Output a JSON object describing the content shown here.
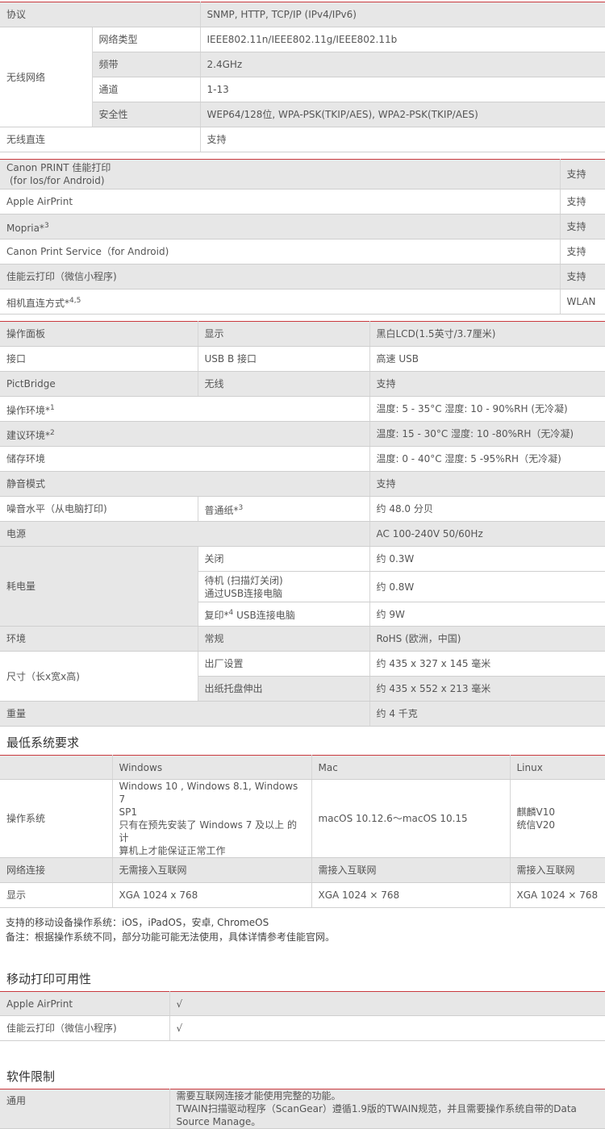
{
  "t1": {
    "protocol_label": "协议",
    "protocol_value": "SNMP, HTTP, TCP/IP (IPv4/IPv6)",
    "wireless_label": "无线网络",
    "net_type_label": "网络类型",
    "net_type_value": "IEEE802.11n/IEEE802.11g/IEEE802.11b",
    "band_label": "频带",
    "band_value": "2.4GHz",
    "channel_label": "通道",
    "channel_value": "1-13",
    "security_label": "安全性",
    "security_value": "WEP64/128位, WPA-PSK(TKIP/AES), WPA2-PSK(TKIP/AES)",
    "direct_label": "无线直连",
    "direct_value": "支持"
  },
  "t2": {
    "rows": [
      {
        "label": "Canon PRINT 佳能打印",
        "label2": "(for Ios/for Android)",
        "sup": "",
        "value": "支持"
      },
      {
        "label": "Apple AirPrint",
        "label2": "",
        "sup": "",
        "value": "支持"
      },
      {
        "label": "Mopria*",
        "label2": "",
        "sup": "3",
        "value": "支持"
      },
      {
        "label": "Canon Print Service（for Android)",
        "label2": "",
        "sup": "",
        "value": "支持"
      },
      {
        "label": "佳能云打印（微信小程序)",
        "label2": "",
        "sup": "",
        "value": "支持"
      },
      {
        "label": "相机直连方式*",
        "label2": "",
        "sup": "4,5",
        "value": "WLAN"
      }
    ]
  },
  "t3": {
    "panel_label": "操作面板",
    "panel_sub": "显示",
    "panel_value": "黑白LCD(1.5英寸/3.7厘米)",
    "iface_label": "接口",
    "iface_sub": "USB B 接口",
    "iface_value": "高速 USB",
    "pict_label": "PictBridge",
    "pict_sub": "无线",
    "pict_value": "支持",
    "op_env_label": "操作环境*",
    "op_env_sup": "1",
    "op_env_value": "温度: 5 - 35°C    湿度: 10 - 90%RH (无冷凝)",
    "rec_env_label": "建议环境*",
    "rec_env_sup": "2",
    "rec_env_value": "温度: 15 - 30°C    湿度: 10 -80%RH（无冷凝)",
    "store_label": "储存环境",
    "store_value": "温度: 0 - 40°C    湿度: 5 -95%RH（无冷凝)",
    "quiet_label": "静音模式",
    "quiet_value": "支持",
    "noise_label": "噪音水平（从电脑打印)",
    "noise_sub": "普通纸*",
    "noise_sup": "3",
    "noise_value": "约 48.0 分贝",
    "power_label": "电源",
    "power_value": "AC 100-240V 50/60Hz",
    "consumption_label": "耗电量",
    "off_label": "关闭",
    "off_value": "约 0.3W",
    "standby_label1": "待机 (扫描灯关闭)",
    "standby_label2": "通过USB连接电脑",
    "standby_value": "约 0.8W",
    "copy_label": "复印*",
    "copy_sup": "4",
    "copy_label_rest": " USB连接电脑",
    "copy_value": "约 9W",
    "env_label": "环境",
    "env_sub": "常规",
    "env_value": "RoHS (欧洲，中国)",
    "size_label": "尺寸（长x宽x高)",
    "factory_label": "出厂设置",
    "factory_value": "约 435 x 327 x 145 毫米",
    "tray_label": "出纸托盘伸出",
    "tray_value": "约 435 x 552 x 213 毫米",
    "weight_label": "重量",
    "weight_value": "约 4 千克"
  },
  "sys_title": "最低系统要求",
  "sys": {
    "headers": [
      "",
      "Windows",
      "Mac",
      "Linux"
    ],
    "os_label": "操作系统",
    "os_win1": "Windows 10 , Windows 8.1, Windows 7",
    "os_win2": "SP1",
    "os_win3": "只有在预先安装了 Windows 7 及以上 的计",
    "os_win4": "算机上才能保证正常工作",
    "os_mac": "macOS 10.12.6～macOS 10.15",
    "os_linux1": "麒麟V10",
    "os_linux2": "统信V20",
    "net_label": "网络连接",
    "net_win": "无需接入互联网",
    "net_mac": "需接入互联网",
    "net_linux": "需接入互联网",
    "disp_label": "显示",
    "disp_win": "XGA 1024 x 768",
    "disp_mac": "XGA 1024 × 768",
    "disp_linux": "XGA 1024 × 768"
  },
  "notes": {
    "line1": "支持的移动设备操作系统：iOS，iPadOS，安卓, ChromeOS",
    "line2": "备注：根据操作系统不同，部分功能可能无法使用，具体详情参考佳能官网。"
  },
  "mobile_title": "移动打印可用性",
  "mobile": [
    {
      "label": "Apple AirPrint",
      "value": "√"
    },
    {
      "label": "佳能云打印（微信小程序)",
      "value": "√"
    }
  ],
  "software_title": "软件限制",
  "software": {
    "label": "通用",
    "line1": "需要互联网连接才能使用完整的功能。",
    "line2": "TWAIN扫描驱动程序（ScanGear）遵循1.9版的TWAIN规范，并且需要操作系统自带的Data",
    "line3": "Source Manage。"
  }
}
